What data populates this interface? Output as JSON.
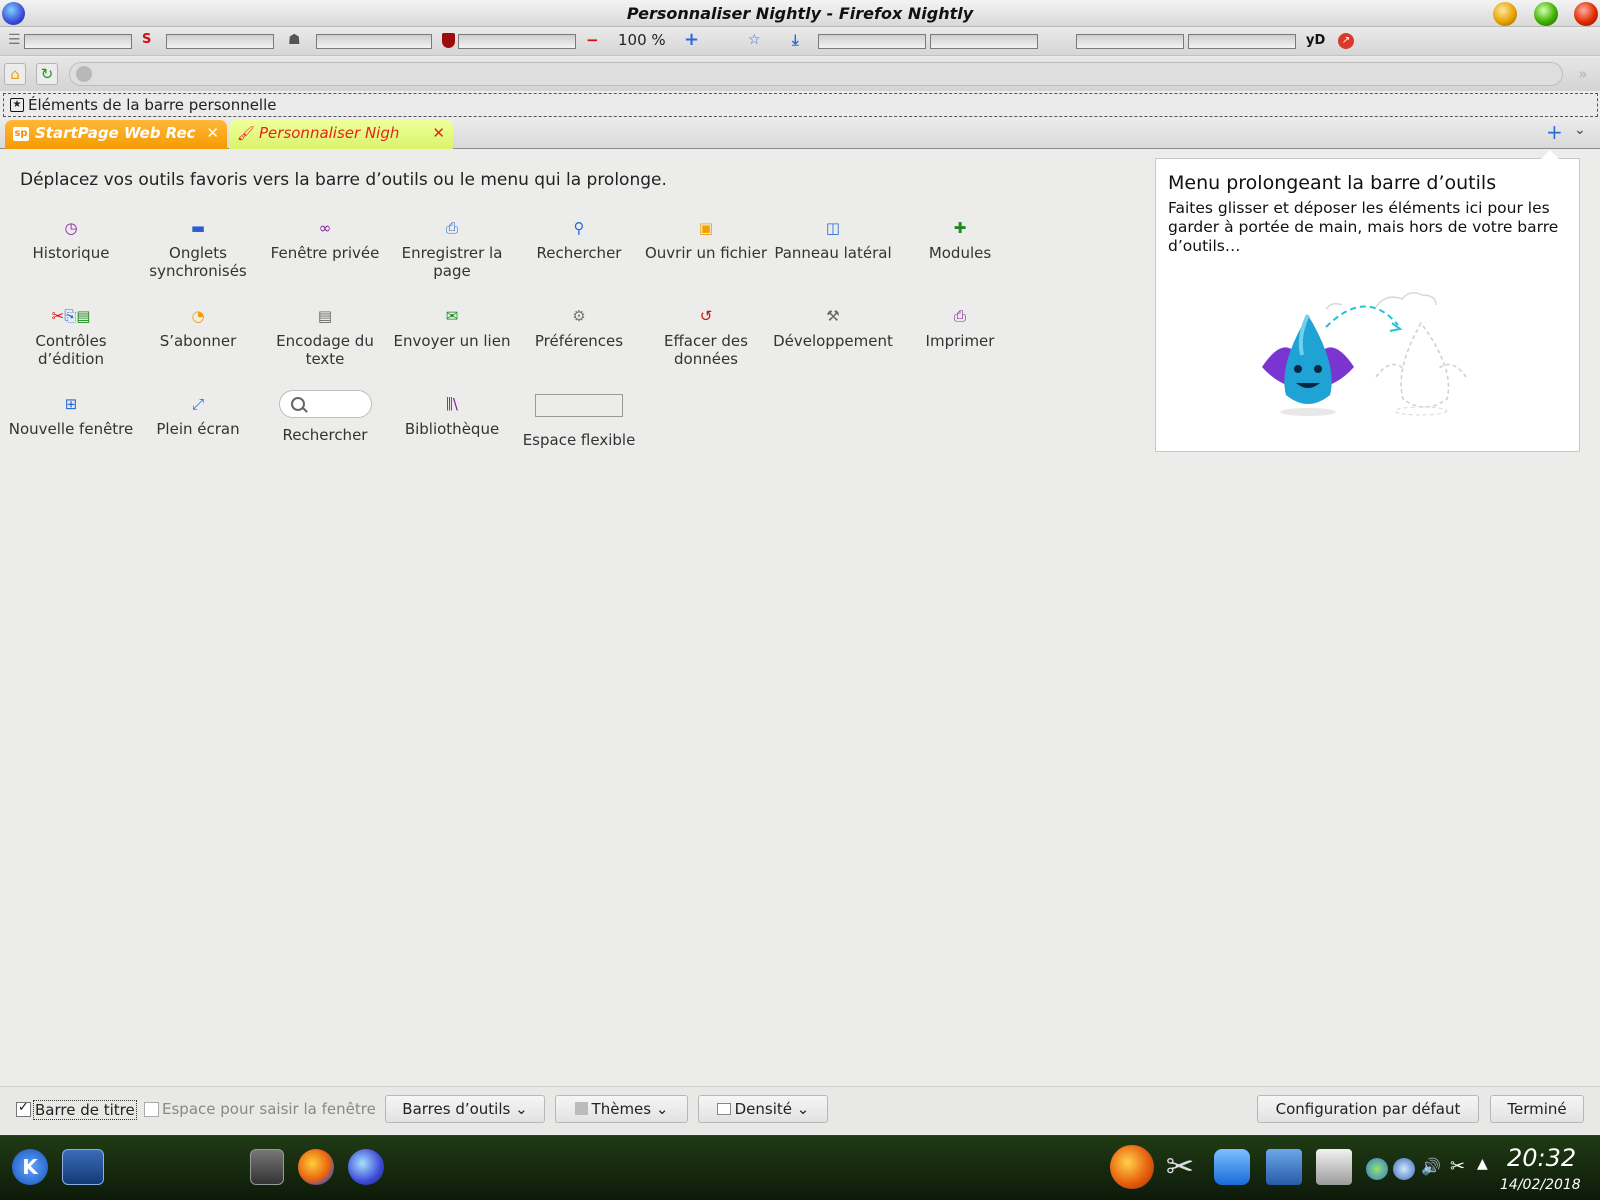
{
  "window": {
    "title": "Personnaliser Nightly - Firefox Nightly"
  },
  "toolbar": {
    "zoom_level": "100 %",
    "zoom_out": "−",
    "zoom_in": "+",
    "yd_label": "yD"
  },
  "bookmarks_bar": {
    "label": "Éléments de la barre personnelle"
  },
  "tabs": [
    {
      "label": "StartPage Web Rec",
      "favicon": "sp"
    },
    {
      "label": "Personnaliser Nigh",
      "favicon": "🖌"
    }
  ],
  "main": {
    "instruction": "Déplacez vos outils favoris vers la barre d’outils ou le menu qui la prolonge.",
    "palette": [
      {
        "label": "Historique",
        "icon": "clock-icon",
        "glyph": "◷",
        "color": "#8a1c9c"
      },
      {
        "label": "Onglets synchronisés",
        "icon": "laptop-icon",
        "glyph": "▬",
        "color": "#2b5ecf"
      },
      {
        "label": "Fenêtre privée",
        "icon": "mask-icon",
        "glyph": "∞",
        "color": "#8a1c9c"
      },
      {
        "label": "Enregistrer la page",
        "icon": "save-page-icon",
        "glyph": "⎙",
        "color": "#2b6bd8"
      },
      {
        "label": "Rechercher",
        "icon": "search-icon",
        "glyph": "⚲",
        "color": "#2b6bd8"
      },
      {
        "label": "Ouvrir un fichier",
        "icon": "open-file-icon",
        "glyph": "▣",
        "color": "#f0a000"
      },
      {
        "label": "Panneau latéral",
        "icon": "sidebar-icon",
        "glyph": "◫",
        "color": "#2b6bd8"
      },
      {
        "label": "Modules",
        "icon": "puzzle-icon",
        "glyph": "✚",
        "color": "#1a8a1a"
      },
      {
        "label": "Contrôles d’édition",
        "icon": "edit-controls-icon",
        "glyph": "✂⎘▤",
        "color": "#d01010"
      },
      {
        "label": "S’abonner",
        "icon": "rss-icon",
        "glyph": "◔",
        "color": "#f0a000"
      },
      {
        "label": "Encodage du texte",
        "icon": "text-encoding-icon",
        "glyph": "▤",
        "color": "#666666"
      },
      {
        "label": "Envoyer un lien",
        "icon": "email-icon",
        "glyph": "✉",
        "color": "#1a8a1a"
      },
      {
        "label": "Préférences",
        "icon": "gear-icon",
        "glyph": "⚙",
        "color": "#777777"
      },
      {
        "label": "Effacer des données",
        "icon": "forget-icon",
        "glyph": "↺",
        "color": "#d01010"
      },
      {
        "label": "Développement",
        "icon": "wrench-icon",
        "glyph": "🔧",
        "color": "#666666"
      },
      {
        "label": "Imprimer",
        "icon": "print-icon",
        "glyph": "⎙",
        "color": "#8a1c9c"
      },
      {
        "label": "Nouvelle fenêtre",
        "icon": "new-window-icon",
        "glyph": "⊞",
        "color": "#2b6bd8"
      },
      {
        "label": "Plein écran",
        "icon": "fullscreen-icon",
        "glyph": "⤢",
        "color": "#2b6bd8"
      },
      {
        "label": "Rechercher",
        "icon": "search-box-icon",
        "glyph": "",
        "color": "#666666"
      },
      {
        "label": "Bibliothèque",
        "icon": "library-icon",
        "glyph": "⫼\\",
        "color": "#8a1c9c"
      },
      {
        "label": "Espace flexible",
        "icon": "flexible-space-icon",
        "glyph": "",
        "color": "#666666"
      }
    ]
  },
  "overflow_panel": {
    "title": "Menu prolongeant la barre d’outils",
    "text": "Faites glisser et déposer les éléments ici pour les garder à portée de main, mais hors de votre barre d’outils…"
  },
  "footer": {
    "title_bar_label": "Barre de titre",
    "title_bar_checked": true,
    "drag_space_label": "Espace pour saisir la fenêtre",
    "drag_space_checked": false,
    "toolbars_button": "Barres d’outils",
    "themes_button": "Thèmes",
    "density_button": "Densité",
    "restore_defaults_button": "Configuration par défaut",
    "done_button": "Terminé"
  },
  "taskbar": {
    "time": "20:32",
    "date": "14/02/2018"
  }
}
